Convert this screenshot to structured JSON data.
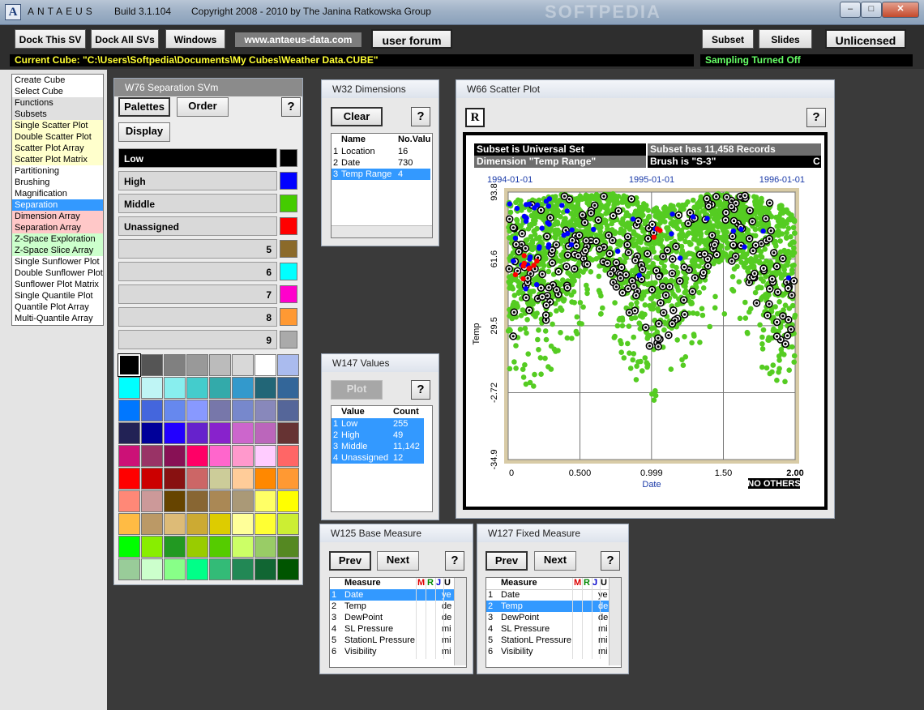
{
  "titlebar": {
    "app_name": "ANTAEUS",
    "build": "Build 3.1.104",
    "copyright": "Copyright 2008 - 2010 by The Janina Ratkowska Group",
    "watermark": "SOFTPEDIA"
  },
  "toolbar": {
    "dock_this": "Dock This SV",
    "dock_all": "Dock All SVs",
    "windows": "Windows",
    "url": "www.antaeus-data.com",
    "forum": "user forum",
    "subset": "Subset",
    "slides": "Slides",
    "license": "Unlicensed",
    "current_cube": "Current Cube: \"C:\\Users\\Softpedia\\Documents\\My Cubes\\Weather Data.CUBE\"",
    "sampling": "Sampling Turned Off"
  },
  "menu": {
    "items": [
      {
        "label": "Create Cube",
        "bg": "#ffffff"
      },
      {
        "label": "Select Cube",
        "bg": "#ffffff"
      },
      {
        "label": "Functions",
        "bg": "#e0e0e0"
      },
      {
        "label": "Subsets",
        "bg": "#e0e0e0"
      },
      {
        "label": "Single Scatter Plot",
        "bg": "#ffffcc"
      },
      {
        "label": "Double Scatter Plot",
        "bg": "#ffffcc"
      },
      {
        "label": "Scatter Plot Array",
        "bg": "#ffffcc"
      },
      {
        "label": "Scatter Plot Matrix",
        "bg": "#ffffcc"
      },
      {
        "label": "Partitioning",
        "bg": "#ffffff"
      },
      {
        "label": "Brushing",
        "bg": "#ffffff"
      },
      {
        "label": "Magnification",
        "bg": "#ffffff"
      },
      {
        "label": "Separation",
        "bg": "#3399ff"
      },
      {
        "label": "Dimension Array",
        "bg": "#ffc8c8"
      },
      {
        "label": "Separation Array",
        "bg": "#ffc8c8"
      },
      {
        "label": "Z-Space Exploration",
        "bg": "#ccffcc"
      },
      {
        "label": "Z-Space Slice Array",
        "bg": "#ccffcc"
      },
      {
        "label": "Single Sunflower Plot",
        "bg": "#ffffff"
      },
      {
        "label": "Double Sunflower Plot",
        "bg": "#ffffff"
      },
      {
        "label": "Sunflower Plot Matrix",
        "bg": "#ffffff"
      },
      {
        "label": "Single Quantile Plot",
        "bg": "#ffffff"
      },
      {
        "label": "Quantile Plot Array",
        "bg": "#ffffff"
      },
      {
        "label": "Multi-Quantile Array",
        "bg": "#ffffff"
      }
    ]
  },
  "svm": {
    "title": "W76  Separation SVm",
    "palettes": "Palettes",
    "order": "Order",
    "help": "?",
    "display": "Display",
    "rows": [
      {
        "label": "Low",
        "color": "#000000",
        "active": true,
        "align": "left"
      },
      {
        "label": "High",
        "color": "#0000ff",
        "active": false,
        "align": "left"
      },
      {
        "label": "Middle",
        "color": "#44cc00",
        "active": false,
        "align": "left"
      },
      {
        "label": "Unassigned",
        "color": "#ff0000",
        "active": false,
        "align": "left"
      },
      {
        "label": "5",
        "color": "#8b6a2a",
        "active": false,
        "align": "right"
      },
      {
        "label": "6",
        "color": "#00ffff",
        "active": false,
        "align": "right"
      },
      {
        "label": "7",
        "color": "#ff00cc",
        "active": false,
        "align": "right"
      },
      {
        "label": "8",
        "color": "#ff9933",
        "active": false,
        "align": "right"
      },
      {
        "label": "9",
        "color": "#aaaaaa",
        "active": false,
        "align": "right"
      }
    ],
    "palette": [
      "#000000",
      "#555555",
      "#808080",
      "#999999",
      "#bbbbbb",
      "#d8d8d8",
      "#ffffff",
      "#aabbee",
      "#00ffff",
      "#bff5f5",
      "#88eeee",
      "#44cccc",
      "#33aaaa",
      "#3399cc",
      "#226677",
      "#336699",
      "#0077ff",
      "#4466dd",
      "#6688ee",
      "#8899ff",
      "#7777aa",
      "#7788cc",
      "#8888bb",
      "#556699",
      "#222255",
      "#000099",
      "#2200ff",
      "#6622cc",
      "#8822cc",
      "#cc66cc",
      "#bb66bb",
      "#663333",
      "#cc1177",
      "#993366",
      "#881155",
      "#ff0066",
      "#ff66cc",
      "#ff99cc",
      "#ffccff",
      "#ff6666",
      "#ff0000",
      "#cc0000",
      "#881111",
      "#cc6666",
      "#cccc99",
      "#ffcc99",
      "#ff8800",
      "#ff9933",
      "#ff8877",
      "#cc9999",
      "#664400",
      "#886633",
      "#aa8855",
      "#aa9977",
      "#ffff66",
      "#ffff00",
      "#ffbb44",
      "#bb9966",
      "#ddbb77",
      "#ccaa33",
      "#ddcc00",
      "#ffff99",
      "#ffff33",
      "#ccee33",
      "#00ff00",
      "#88ee00",
      "#229922",
      "#99cc00",
      "#55cc00",
      "#ccff66",
      "#99cc66",
      "#558822",
      "#99cc99",
      "#ccffcc",
      "#88ff88",
      "#00ff88",
      "#33bb77",
      "#228855",
      "#116633",
      "#005500"
    ]
  },
  "dimensions": {
    "title": "W32  Dimensions",
    "clear": "Clear",
    "help": "?",
    "col_name": "Name",
    "col_vals": "No.Valu",
    "rows": [
      {
        "i": "1",
        "name": "Location",
        "n": "16",
        "sel": false
      },
      {
        "i": "2",
        "name": "Date",
        "n": "730",
        "sel": false
      },
      {
        "i": "3",
        "name": "Temp Range",
        "n": "4",
        "sel": true
      }
    ]
  },
  "values": {
    "title": "W147  Values",
    "plot": "Plot",
    "help": "?",
    "col_value": "Value",
    "col_count": "Count",
    "rows": [
      {
        "i": "1",
        "v": "Low",
        "c": "255"
      },
      {
        "i": "2",
        "v": "High",
        "c": "49"
      },
      {
        "i": "3",
        "v": "Middle",
        "c": "11,142"
      },
      {
        "i": "4",
        "v": "Unassigned",
        "c": "12"
      }
    ]
  },
  "base": {
    "title": "W125  Base Measure",
    "prev": "Prev",
    "next": "Next",
    "help": "?",
    "col_measure": "Measure",
    "col_m": "M",
    "col_r": "R",
    "col_j": "J",
    "col_u": "U",
    "rows": [
      {
        "i": "1",
        "m": "Date",
        "u": "ye",
        "sel": true
      },
      {
        "i": "2",
        "m": "Temp",
        "u": "de",
        "sel": false
      },
      {
        "i": "3",
        "m": "DewPoint",
        "u": "de",
        "sel": false
      },
      {
        "i": "4",
        "m": "SL Pressure",
        "u": "mi",
        "sel": false
      },
      {
        "i": "5",
        "m": "StationL Pressure",
        "u": "mi",
        "sel": false
      },
      {
        "i": "6",
        "m": "Visibility",
        "u": "mi",
        "sel": false
      }
    ]
  },
  "fixed": {
    "title": "W127  Fixed Measure",
    "prev": "Prev",
    "next": "Next",
    "help": "?",
    "col_measure": "Measure",
    "col_m": "M",
    "col_r": "R",
    "col_j": "J",
    "col_u": "U",
    "rows": [
      {
        "i": "1",
        "m": "Date",
        "u": "ye",
        "sel": false
      },
      {
        "i": "2",
        "m": "Temp",
        "u": "de",
        "sel": true
      },
      {
        "i": "3",
        "m": "DewPoint",
        "u": "de",
        "sel": false
      },
      {
        "i": "4",
        "m": "SL Pressure",
        "u": "mi",
        "sel": false
      },
      {
        "i": "5",
        "m": "StationL Pressure",
        "u": "mi",
        "sel": false
      },
      {
        "i": "6",
        "m": "Visibility",
        "u": "mi",
        "sel": false
      }
    ]
  },
  "scatter": {
    "title": "W66  Scatter Plot",
    "r_button": "R",
    "help": "?",
    "info_subset": "Subset is Universal Set",
    "info_records": "Subset has 11,458 Records",
    "info_dimension": "Dimension \"Temp Range\"",
    "info_brush": "Brush is \"S-3\"",
    "info_c": "C",
    "no_others": "NO OTHERS"
  },
  "chart_data": {
    "type": "scatter",
    "title": "",
    "xlabel": "Date",
    "ylabel": "Temp",
    "xlim": [
      0,
      2.0
    ],
    "ylim": [
      -34.9,
      93.8
    ],
    "x_ticks": [
      "0",
      "0.500",
      "0.999",
      "1.50",
      "2.00"
    ],
    "x_tick_values": [
      0,
      0.5,
      0.999,
      1.5,
      2.0
    ],
    "y_ticks": [
      "93.8",
      "61.6",
      "29.5",
      "-2.72",
      "-34.9"
    ],
    "y_tick_values": [
      93.8,
      61.6,
      29.5,
      -2.72,
      -34.9
    ],
    "top_axis_labels": [
      "1994-01-01",
      "1995-01-01",
      "1996-01-01"
    ],
    "top_axis_values": [
      0,
      1.0,
      2.0
    ],
    "grid": true,
    "legend_position": "bottom",
    "series": [
      {
        "name": "Low",
        "color": "#000000",
        "marker": "ring",
        "count": 255
      },
      {
        "name": "High",
        "color": "#0000ff",
        "marker": "dot",
        "count": 49
      },
      {
        "name": "Middle",
        "color": "#55cc22",
        "marker": "dot",
        "count": 11142
      },
      {
        "name": "Unassigned",
        "color": "#ff0000",
        "marker": "dot",
        "count": 12
      }
    ],
    "temp_envelope": [
      [
        0.0,
        24,
        90
      ],
      [
        0.1,
        22,
        90
      ],
      [
        0.2,
        26,
        91
      ],
      [
        0.3,
        32,
        92
      ],
      [
        0.4,
        40,
        93
      ],
      [
        0.5,
        52,
        92
      ],
      [
        0.6,
        62,
        93
      ],
      [
        0.7,
        54,
        93
      ],
      [
        0.8,
        38,
        93
      ],
      [
        0.9,
        26,
        91
      ],
      [
        1.0,
        16,
        86
      ],
      [
        1.1,
        22,
        87
      ],
      [
        1.2,
        30,
        89
      ],
      [
        1.3,
        40,
        92
      ],
      [
        1.4,
        52,
        93
      ],
      [
        1.5,
        60,
        93
      ],
      [
        1.6,
        58,
        93
      ],
      [
        1.7,
        44,
        92
      ],
      [
        1.8,
        30,
        90
      ],
      [
        1.9,
        20,
        88
      ],
      [
        2.0,
        16,
        86
      ]
    ]
  }
}
